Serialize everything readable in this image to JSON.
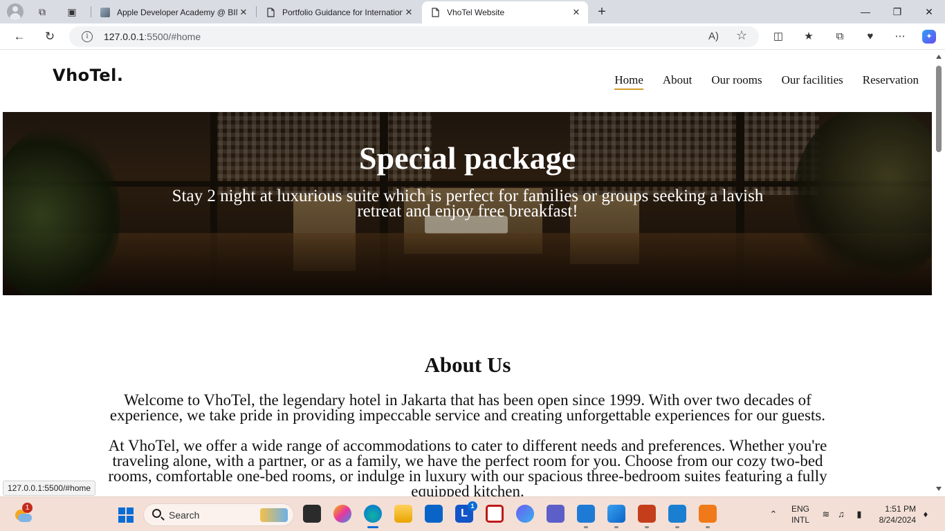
{
  "browser": {
    "tabs": [
      {
        "title": "Apple Developer Academy @ BINUS"
      },
      {
        "title": "Portfolio Guidance for International"
      },
      {
        "title": "VhoTel Website"
      }
    ],
    "url_host": "127.0.0.1",
    "url_path": ":5500/#home",
    "status_url": "127.0.0.1:5500/#home"
  },
  "site": {
    "logo": "VhoTel.",
    "nav": [
      "Home",
      "About",
      "Our rooms",
      "Our facilities",
      "Reservation"
    ]
  },
  "hero": {
    "title": "Special package",
    "text": "Stay 2 night at luxurious suite which is perfect for families or groups seeking a lavish retreat and enjoy free breakfast!"
  },
  "about": {
    "title": "About Us",
    "p1": "Welcome to VhoTel, the legendary hotel in Jakarta that has been open since 1999. With over two decades of experience, we take pride in providing impeccable service and creating unforgettable experiences for our guests.",
    "p2": "At VhoTel, we offer a wide range of accommodations to cater to different needs and preferences. Whether you're traveling alone, with a partner, or as a family, we have the perfect room for you. Choose from our cozy two-bed rooms, comfortable one-bed rooms, or indulge in luxury with our spacious three-bedroom suites featuring a fully equipped kitchen."
  },
  "taskbar": {
    "search_label": "Search",
    "weather_badge": "1",
    "outlook_badge": "1",
    "lang_line1": "ENG",
    "lang_line2": "INTL",
    "time": "1:51 PM",
    "date": "8/24/2024"
  },
  "colors": {
    "nav_underline": "#d39a2a",
    "windows_blue": "#0a6cd6"
  }
}
